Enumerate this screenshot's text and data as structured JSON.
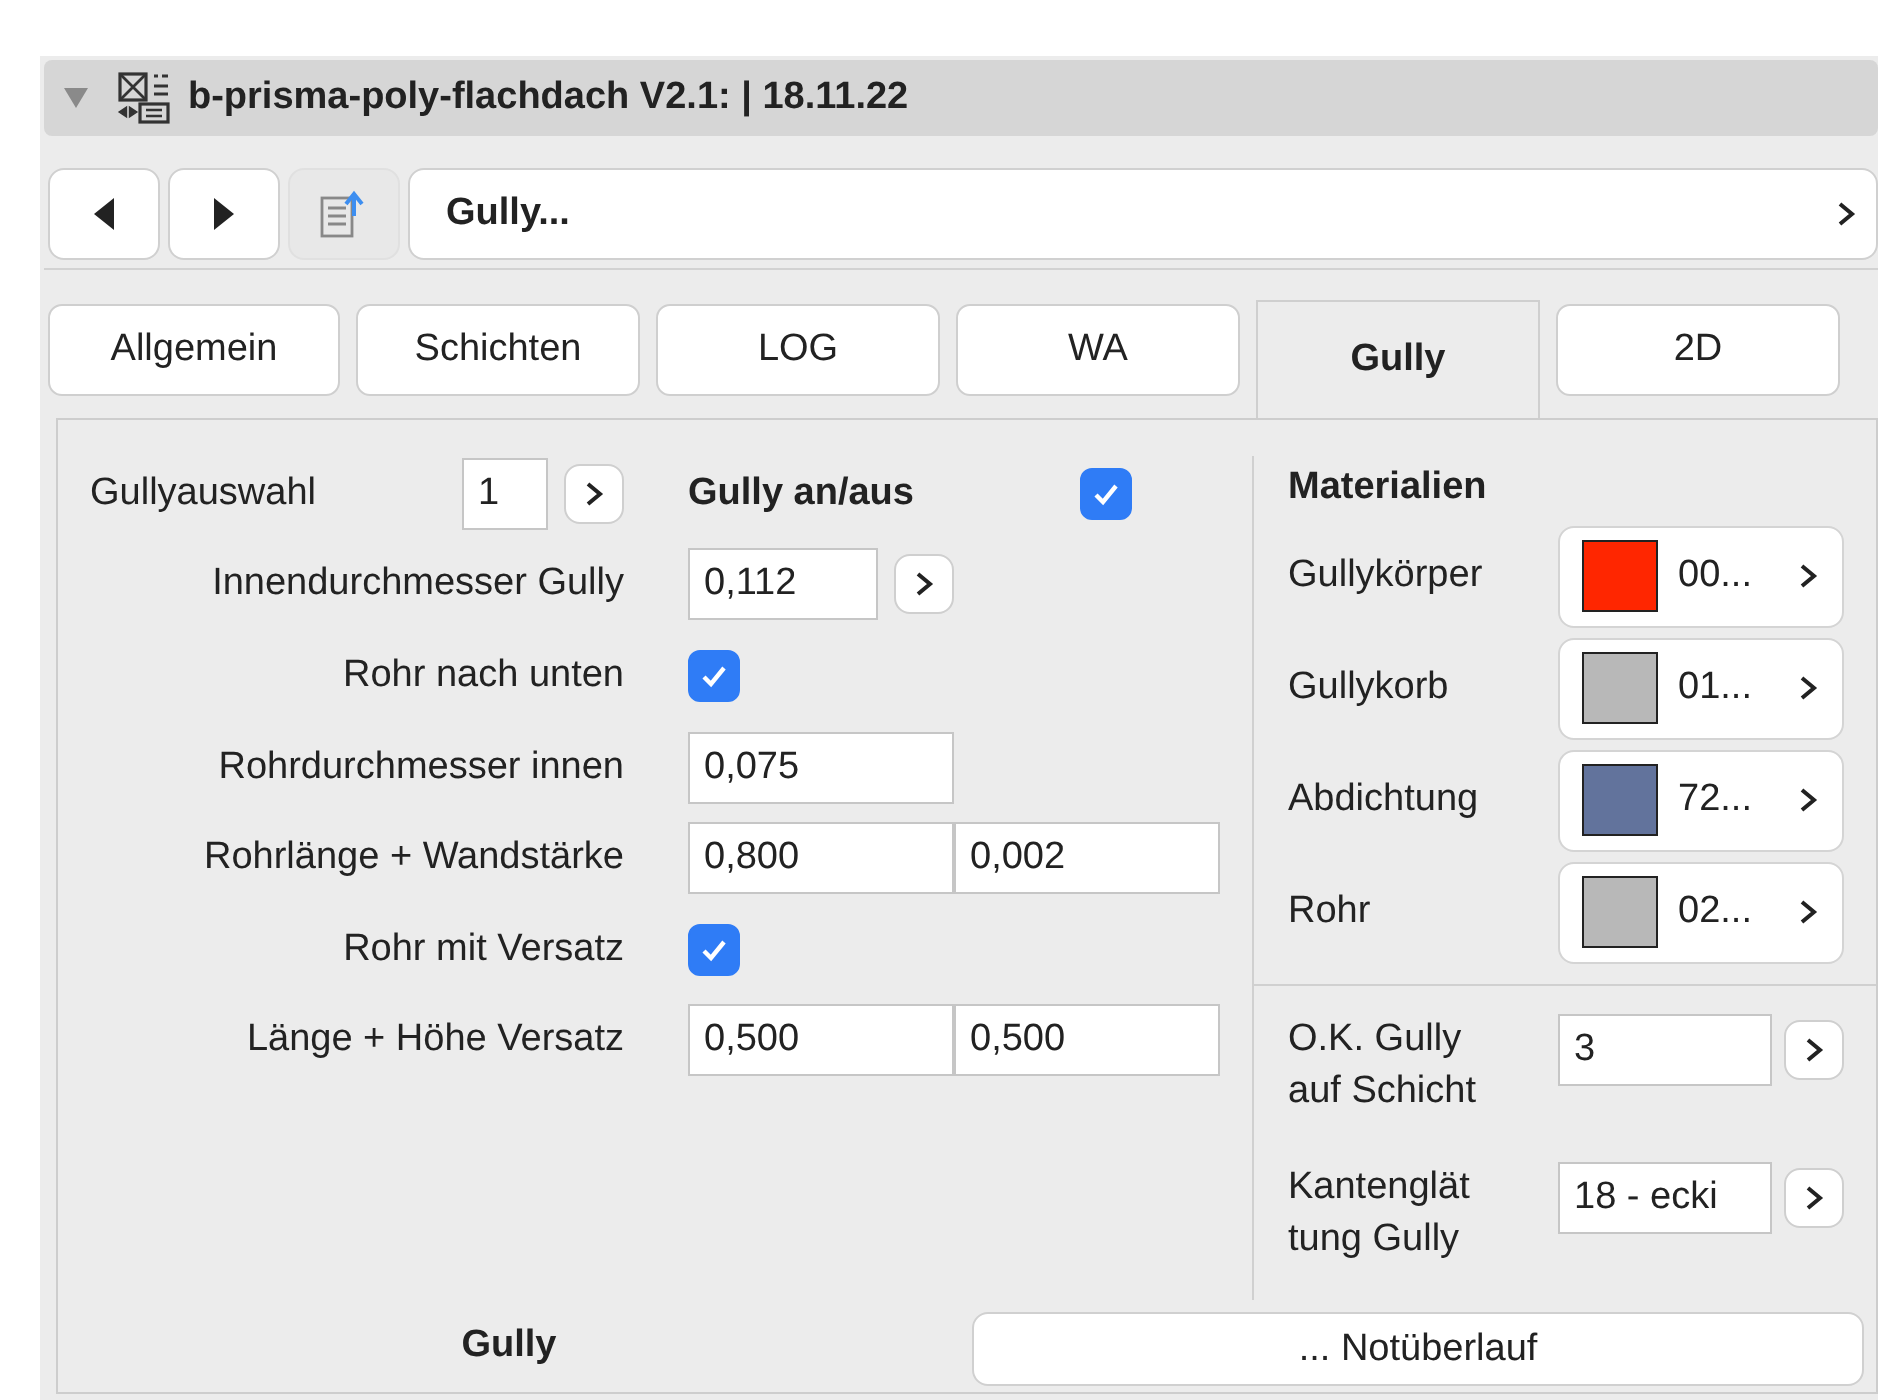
{
  "header": {
    "title": "b-prisma-poly-flachdach V2.1: | 18.11.22",
    "expanded": true
  },
  "nav": {
    "path": "Gully..."
  },
  "tabs": [
    {
      "label": "Allgemein",
      "selected": false
    },
    {
      "label": "Schichten",
      "selected": false
    },
    {
      "label": "LOG",
      "selected": false
    },
    {
      "label": "WA",
      "selected": false
    },
    {
      "label": "Gully",
      "selected": true
    },
    {
      "label": "2D",
      "selected": false
    }
  ],
  "top_row": {
    "label": "Gullyauswahl",
    "value": "1",
    "switch_label": "Gully an/aus",
    "checked": true
  },
  "rows": [
    {
      "kind": "field_button",
      "label": "Innendurchmesser Gully",
      "value": "0,112"
    },
    {
      "kind": "checkbox",
      "label": "Rohr nach unten",
      "checked": true
    },
    {
      "kind": "field",
      "label": "Rohrdurchmesser innen",
      "value": "0,075"
    },
    {
      "kind": "field_pair",
      "label": "Rohrlänge + Wandstärke",
      "values": [
        "0,800",
        "0,002"
      ]
    },
    {
      "kind": "checkbox",
      "label": "Rohr mit Versatz",
      "checked": true
    },
    {
      "kind": "field_pair",
      "label": "Länge + Höhe Versatz",
      "values": [
        "0,500",
        "0,500"
      ]
    }
  ],
  "materials": {
    "title": "Materialien",
    "items": [
      {
        "label": "Gullykörper",
        "color": "#ff2600",
        "code": "00..."
      },
      {
        "label": "Gullykorb",
        "color": "#b8b8b8",
        "code": "01..."
      },
      {
        "label": "Abdichtung",
        "color": "#62739c",
        "code": "72..."
      },
      {
        "label": "Rohr",
        "color": "#b8b8b8",
        "code": "02..."
      }
    ]
  },
  "settings": [
    {
      "lines": [
        "O.K. Gully",
        "auf Schicht"
      ],
      "value": "3"
    },
    {
      "lines": [
        "Kantenglät",
        "tung Gully"
      ],
      "value": "18 - ecki"
    }
  ],
  "bottom_tabs": [
    {
      "label": "Gully",
      "selected": true
    },
    {
      "label": "... Notüberlauf",
      "selected": false
    }
  ]
}
